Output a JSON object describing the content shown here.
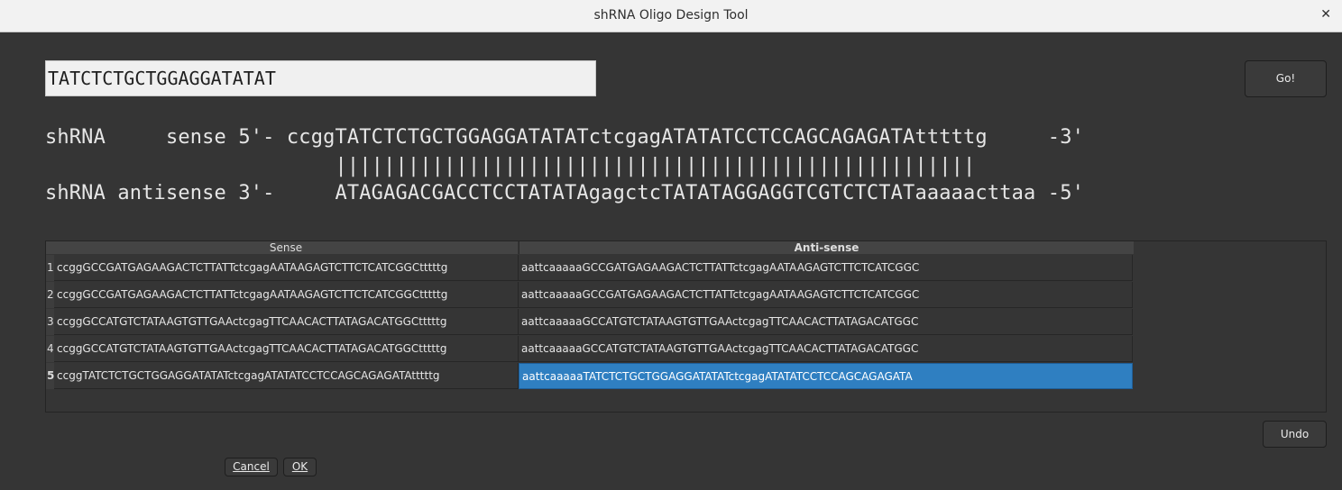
{
  "window": {
    "title": "shRNA Oligo Design Tool",
    "close_glyph": "✕"
  },
  "input": {
    "value": "TATCTCTGCTGGAGGATATAT"
  },
  "buttons": {
    "go": "Go!",
    "undo": "Undo",
    "cancel": "Cancel",
    "ok": "OK"
  },
  "alignment": {
    "sense_line": "shRNA     sense 5'- ccggTATCTCTGCTGGAGGATATATctcgagATATATCCTCCAGCAGAGATAtttttg     -3'",
    "bond_line": "                        |||||||||||||||||||||||||||||||||||||||||||||||||||||",
    "antisense_line": "shRNA antisense 3'-     ATAGAGACGACCTCCTATATAgagctcTATATAGGAGGTCGTCTCTATaaaaacttaa -5'"
  },
  "table": {
    "headers": {
      "sense": "Sense",
      "antisense": "Anti-sense"
    },
    "rows": [
      {
        "num": "1",
        "sense": "ccggGCCGATGAGAAGACTCTTATTctcgagAATAAGAGTCTTCTCATCGGCtttttg",
        "antisense": "aattcaaaaaGCCGATGAGAAGACTCTTATTctcgagAATAAGAGTCTTCTCATCGGC"
      },
      {
        "num": "2",
        "sense": "ccggGCCGATGAGAAGACTCTTATTctcgagAATAAGAGTCTTCTCATCGGCtttttg",
        "antisense": "aattcaaaaaGCCGATGAGAAGACTCTTATTctcgagAATAAGAGTCTTCTCATCGGC"
      },
      {
        "num": "3",
        "sense": "ccggGCCATGTCTATAAGTGTTGAActcgagTTCAACACTTATAGACATGGCtttttg",
        "antisense": "aattcaaaaaGCCATGTCTATAAGTGTTGAActcgagTTCAACACTTATAGACATGGC"
      },
      {
        "num": "4",
        "sense": "ccggGCCATGTCTATAAGTGTTGAActcgagTTCAACACTTATAGACATGGCtttttg",
        "antisense": "aattcaaaaaGCCATGTCTATAAGTGTTGAActcgagTTCAACACTTATAGACATGGC"
      },
      {
        "num": "5",
        "sense": "ccggTATCTCTGCTGGAGGATATATctcgagATATATCCTCCAGCAGAGATAtttttg",
        "antisense": "aattcaaaaaTATCTCTGCTGGAGGATATATctcgagATATATCCTCCAGCAGAGATA"
      }
    ]
  },
  "colors": {
    "background": "#353535",
    "selection": "#2f7fc1"
  }
}
